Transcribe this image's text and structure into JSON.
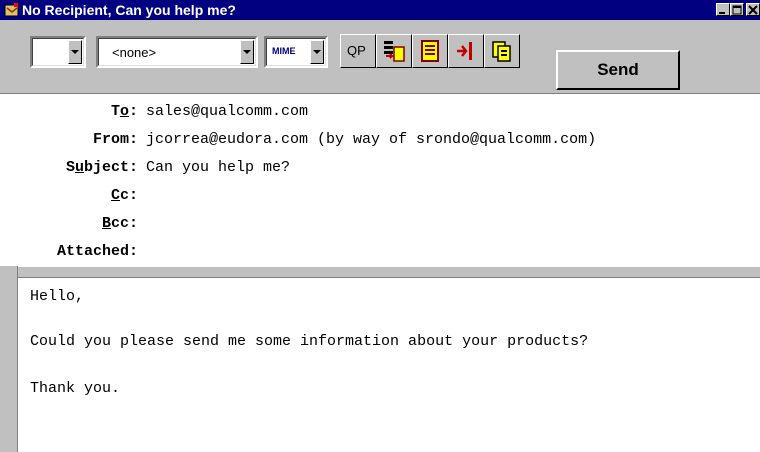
{
  "window": {
    "title": "No Recipient, Can you help me?",
    "title_bar_color": "#000080",
    "controls": [
      "minimize-icon",
      "maximize-icon",
      "close-icon"
    ]
  },
  "toolbar": {
    "combo1_value": "",
    "combo2_value": "<none>",
    "mime_label": "MIME",
    "qp_label": "QP",
    "send_label": "Send",
    "icons": [
      "attach-signature-icon",
      "text-as-document-icon",
      "tab-insert-icon",
      "copy-to-outbox-icon"
    ]
  },
  "headers": {
    "to_label_pre": "T",
    "to_label_u": "o",
    "to_label_post": ":",
    "to_value": "sales@qualcomm.com",
    "from_label": "From:",
    "from_value": "jcorrea@eudora.com (by way of srondo@qualcomm.com)",
    "subject_label_pre": "S",
    "subject_label_u": "u",
    "subject_label_post": "bject:",
    "subject_value": "Can you help me?",
    "cc_label_u": "C",
    "cc_label_post": "c:",
    "bcc_label_u": "B",
    "bcc_label_post": "cc:",
    "attached_label": "Attached:"
  },
  "body": {
    "line1": "Hello,",
    "line2": "Could you please send me some information about your products?",
    "line3": "Thank you."
  }
}
